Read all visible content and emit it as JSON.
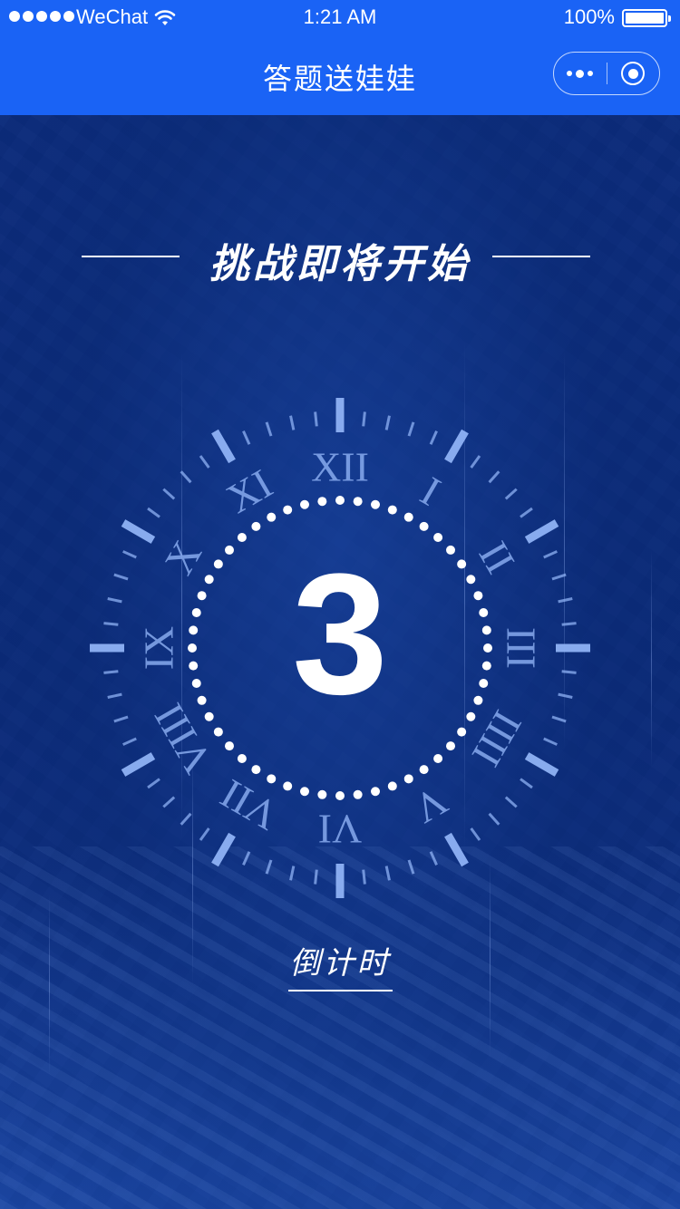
{
  "status_bar": {
    "carrier": "WeChat",
    "time": "1:21 AM",
    "battery": "100%"
  },
  "nav": {
    "title": "答题送娃娃"
  },
  "content": {
    "heading": "挑战即将开始",
    "countdown": "3",
    "label": "倒计时"
  },
  "dial": {
    "numerals": [
      "XII",
      "I",
      "II",
      "III",
      "IIII",
      "V",
      "VI",
      "VII",
      "VIII",
      "IX",
      "X",
      "XI"
    ]
  },
  "colors": {
    "nav_blue": "#1a63f5",
    "background": "#0b2f86",
    "dial_light": "#8fb2f5"
  }
}
